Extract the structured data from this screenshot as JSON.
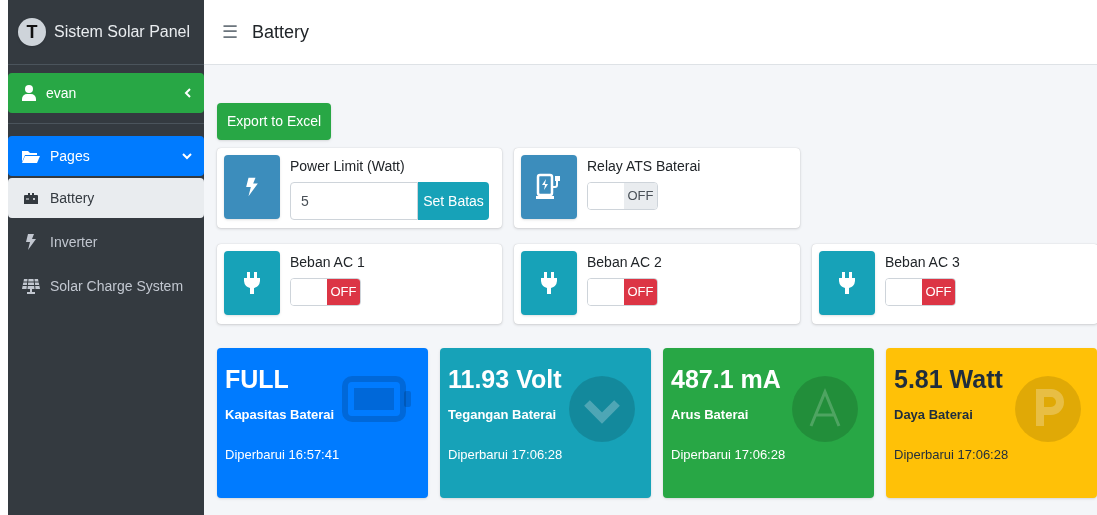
{
  "brand": {
    "logo": "T",
    "title": "Sistem Solar Panel"
  },
  "user": {
    "name": "evan",
    "expanded": false
  },
  "nav": {
    "label": "Pages",
    "expanded": true,
    "items": [
      {
        "label": "Battery",
        "selected": true
      },
      {
        "label": "Inverter",
        "selected": false
      },
      {
        "label": "Solar Charge System",
        "selected": false
      }
    ]
  },
  "header": {
    "menu_glyph": "☰",
    "title": "Battery"
  },
  "export_button": "Export to Excel",
  "power_limit": {
    "label": "Power Limit (Watt)",
    "value": "5",
    "button": "Set Batas"
  },
  "relay": {
    "label": "Relay ATS Baterai",
    "on": false,
    "state_text": "OFF",
    "kind": "plain"
  },
  "loads": [
    {
      "label": "Beban AC 1",
      "on": false,
      "state_text": "OFF",
      "kind": "danger"
    },
    {
      "label": "Beban AC 2",
      "on": false,
      "state_text": "OFF",
      "kind": "danger"
    },
    {
      "label": "Beban AC 3",
      "on": false,
      "state_text": "OFF",
      "kind": "danger"
    }
  ],
  "stats": [
    {
      "value": "FULL",
      "label": "Kapasitas Baterai",
      "updated": "Diperbarui 16:57:41",
      "color": "#007bff"
    },
    {
      "value": "11.93 Volt",
      "label": "Tegangan Baterai",
      "updated": "Diperbarui 17:06:28",
      "color": "#17a2b8"
    },
    {
      "value": "487.1 mA",
      "label": "Arus Baterai",
      "updated": "Diperbarui 17:06:28",
      "color": "#28a745"
    },
    {
      "value": "5.81 Watt",
      "label": "Daya Baterai",
      "updated": "Diperbarui 17:06:28",
      "color": "#ffc107"
    }
  ]
}
